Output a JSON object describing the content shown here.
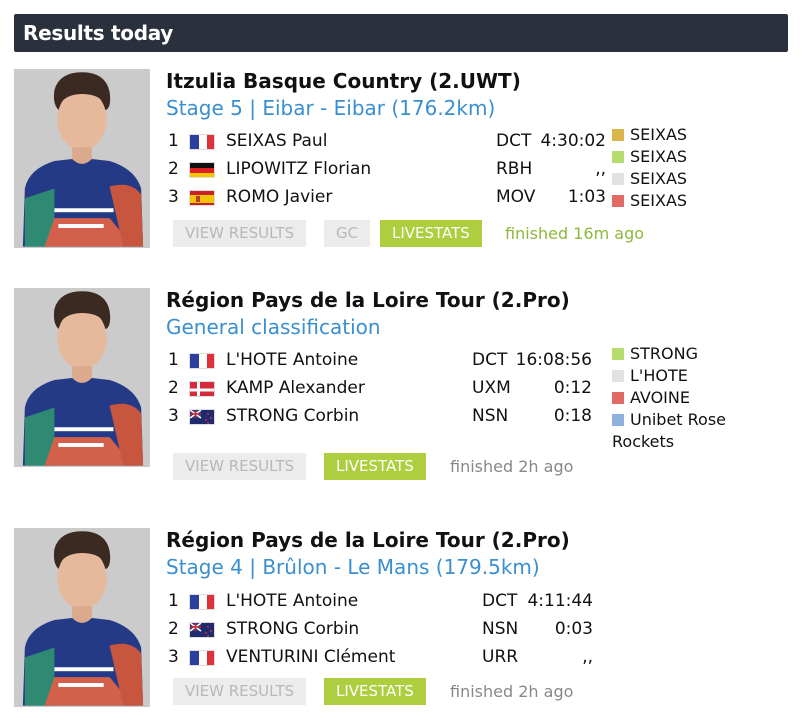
{
  "header": {
    "title": "Results today"
  },
  "colors": {
    "header_bg": "#2a313c",
    "link_blue": "#3a8fd0",
    "livestats_green": "#aecd3f",
    "jersey_yellow": "#d9b54a",
    "jersey_green": "#b5dd6e",
    "jersey_white": "#e2e2e2",
    "jersey_red": "#e06a66",
    "jersey_blue": "#8db0dc"
  },
  "races": [
    {
      "title": "Itzulia Basque Country (2.UWT)",
      "subtitle": "Stage 5 | Eibar - Eibar (176.2km)",
      "results": [
        {
          "pos": "1",
          "flag": "france",
          "name": "SEIXAS Paul",
          "team": "DCT",
          "time": "4:30:02"
        },
        {
          "pos": "2",
          "flag": "germany",
          "name": "LIPOWITZ Florian",
          "team": "RBH",
          "time": ",,"
        },
        {
          "pos": "3",
          "flag": "spain",
          "name": "ROMO Javier",
          "team": "MOV",
          "time": "1:03"
        }
      ],
      "jerseys": [
        {
          "color": "yellow",
          "label": "SEIXAS"
        },
        {
          "color": "green",
          "label": "SEIXAS"
        },
        {
          "color": "white",
          "label": "SEIXAS"
        },
        {
          "color": "red",
          "label": "SEIXAS"
        }
      ],
      "buttons": {
        "view": "VIEW RESULTS",
        "gc": "GC",
        "live": "LIVESTATS"
      },
      "finished": "finished 16m ago"
    },
    {
      "title": "Région Pays de la Loire Tour (2.Pro)",
      "subtitle": "General classification",
      "results": [
        {
          "pos": "1",
          "flag": "france",
          "name": "L'HOTE Antoine",
          "team": "DCT",
          "time": "16:08:56"
        },
        {
          "pos": "2",
          "flag": "denmark",
          "name": "KAMP Alexander",
          "team": "UXM",
          "time": "0:12"
        },
        {
          "pos": "3",
          "flag": "new-zealand",
          "name": "STRONG Corbin",
          "team": "NSN",
          "time": "0:18"
        }
      ],
      "jerseys": [
        {
          "color": "green",
          "label": "STRONG"
        },
        {
          "color": "white",
          "label": "L'HOTE"
        },
        {
          "color": "red",
          "label": "AVOINE"
        },
        {
          "color": "blue",
          "label": "Unibet Rose"
        },
        {
          "color": "none",
          "label": "Rockets"
        }
      ],
      "buttons": {
        "view": "VIEW RESULTS",
        "live": "LIVESTATS"
      },
      "finished": "finished 2h ago"
    },
    {
      "title": "Région Pays de la Loire Tour (2.Pro)",
      "subtitle": "Stage 4 | Brûlon - Le Mans (179.5km)",
      "results": [
        {
          "pos": "1",
          "flag": "france",
          "name": "L'HOTE Antoine",
          "team": "DCT",
          "time": "4:11:44"
        },
        {
          "pos": "2",
          "flag": "new-zealand",
          "name": "STRONG Corbin",
          "team": "NSN",
          "time": "0:03"
        },
        {
          "pos": "3",
          "flag": "france",
          "name": "VENTURINI Clément",
          "team": "URR",
          "time": ",,"
        }
      ],
      "buttons": {
        "view": "VIEW RESULTS",
        "live": "LIVESTATS"
      },
      "finished": "finished 2h ago"
    }
  ]
}
